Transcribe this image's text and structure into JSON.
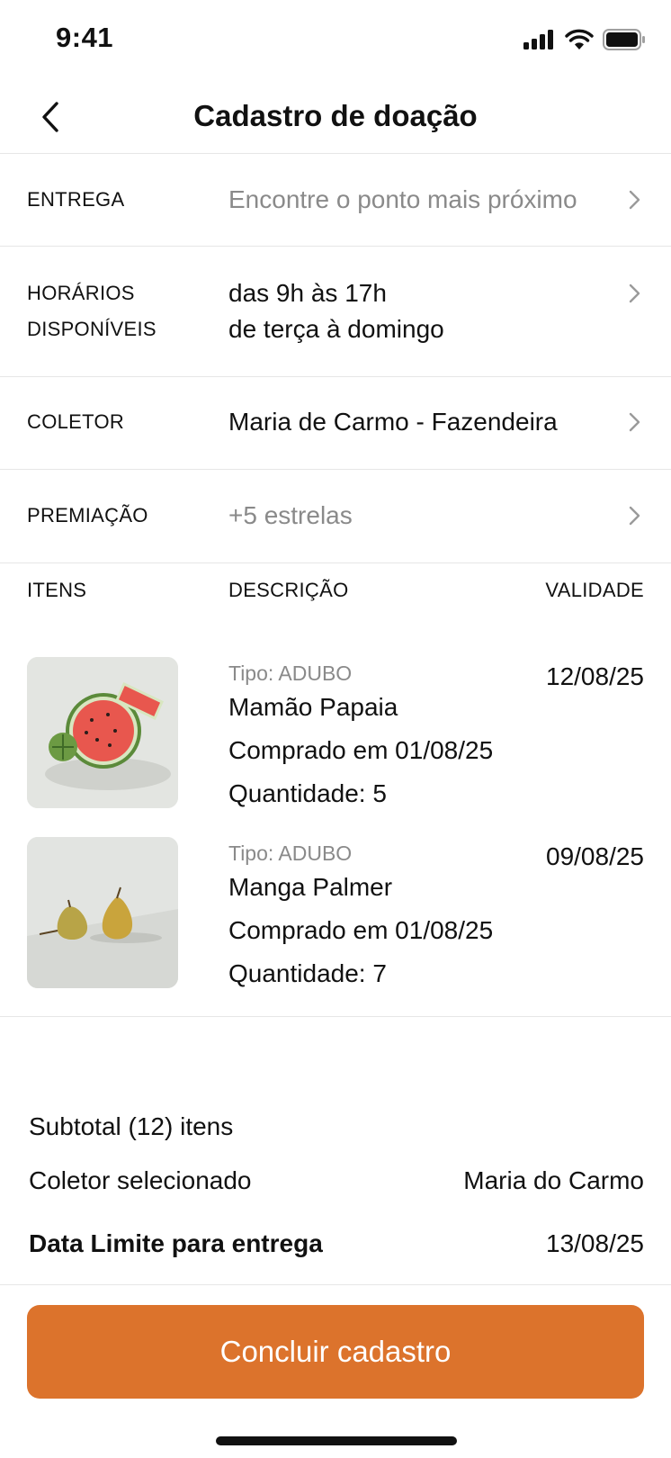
{
  "status_bar": {
    "time": "9:41"
  },
  "navbar": {
    "title": "Cadastro de doação"
  },
  "rows": [
    {
      "label": "ENTREGA",
      "value": "Encontre o ponto mais próximo"
    },
    {
      "label_line1": "HORÁRIOS",
      "label_line2": "DISPONÍVEIS",
      "value_line1": "das 9h às 17h",
      "value_line2": "de terça à domingo"
    },
    {
      "label": "COLETOR",
      "value": "Maria de Carmo - Fazendeira"
    },
    {
      "label": "PREMIAÇÃO",
      "value": "+5 estrelas"
    }
  ],
  "items_header": {
    "col1": "ITENS",
    "col2": "DESCRIÇÃO",
    "col3": "VALIDADE"
  },
  "items": [
    {
      "type": "Tipo: ADUBO",
      "name": "Mamão Papaia",
      "bought": "Comprado em 01/08/25",
      "quantity": "Quantidade: 5",
      "validity": "12/08/25"
    },
    {
      "type": "Tipo: ADUBO",
      "name": "Manga Palmer",
      "bought": "Comprado em 01/08/25",
      "quantity": "Quantidade: 7",
      "validity": "09/08/25"
    }
  ],
  "summary": {
    "subtotal": "Subtotal (12) itens",
    "collector_label": "Coletor selecionado",
    "collector_value": "Maria do Carmo",
    "deadline_label": "Data Limite para entrega",
    "deadline_value": "13/08/25"
  },
  "cta": {
    "label": "Concluir cadastro"
  },
  "colors": {
    "accent": "#dc732c",
    "muted_text": "#8a8a8a",
    "divider": "#e6e6e6"
  },
  "icons": [
    "signal-icon",
    "wifi-icon",
    "battery-icon",
    "back-chevron-icon",
    "chevron-right-icon"
  ]
}
